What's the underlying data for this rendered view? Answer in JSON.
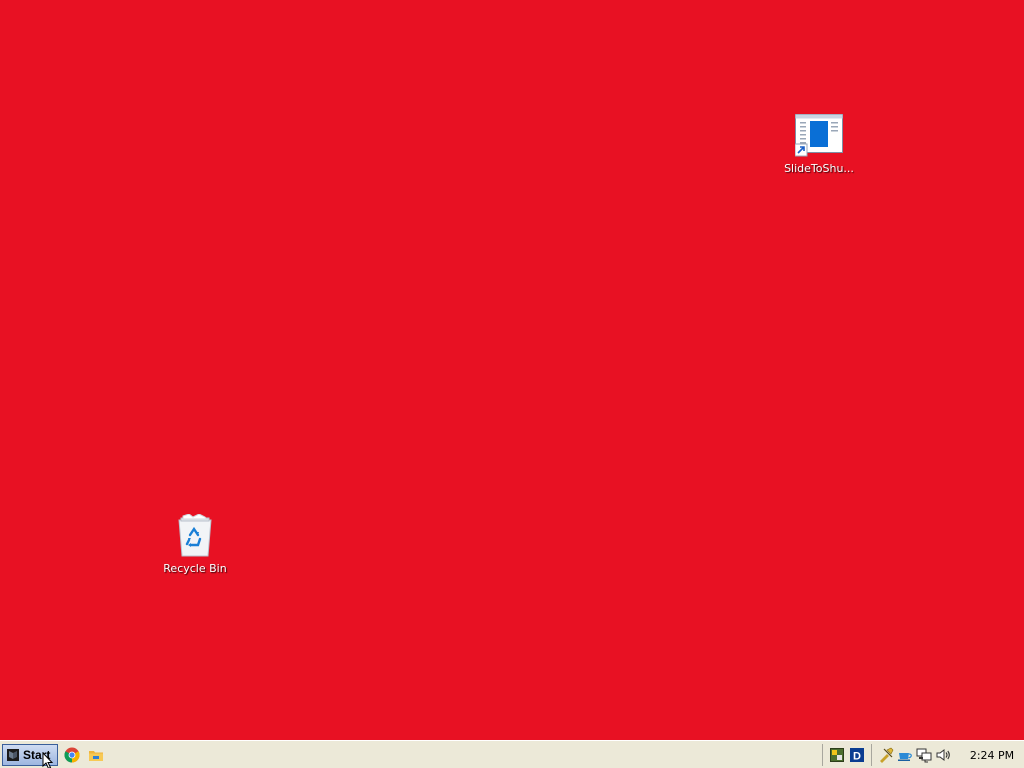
{
  "colors": {
    "desktop_background": "#e81123",
    "taskbar_background": "#ece9d8",
    "label_text": "#ffffff"
  },
  "desktop": {
    "icons": [
      {
        "label": "SlideToShu...",
        "icon": "window-shortcut-icon"
      },
      {
        "label": "Recycle Bin",
        "icon": "recycle-bin-icon"
      }
    ]
  },
  "taskbar": {
    "start_label": "Start",
    "quick_launch": [
      {
        "icon": "chrome-icon"
      },
      {
        "icon": "file-explorer-icon"
      }
    ],
    "tray": {
      "icons": [
        {
          "icon": "app-tray-icon"
        },
        {
          "icon": "d-tray-icon"
        },
        {
          "icon": "tool-tray-icon"
        },
        {
          "icon": "cup-tray-icon"
        },
        {
          "icon": "network-icon"
        },
        {
          "icon": "volume-icon"
        }
      ],
      "clock": "2:24 PM"
    }
  }
}
